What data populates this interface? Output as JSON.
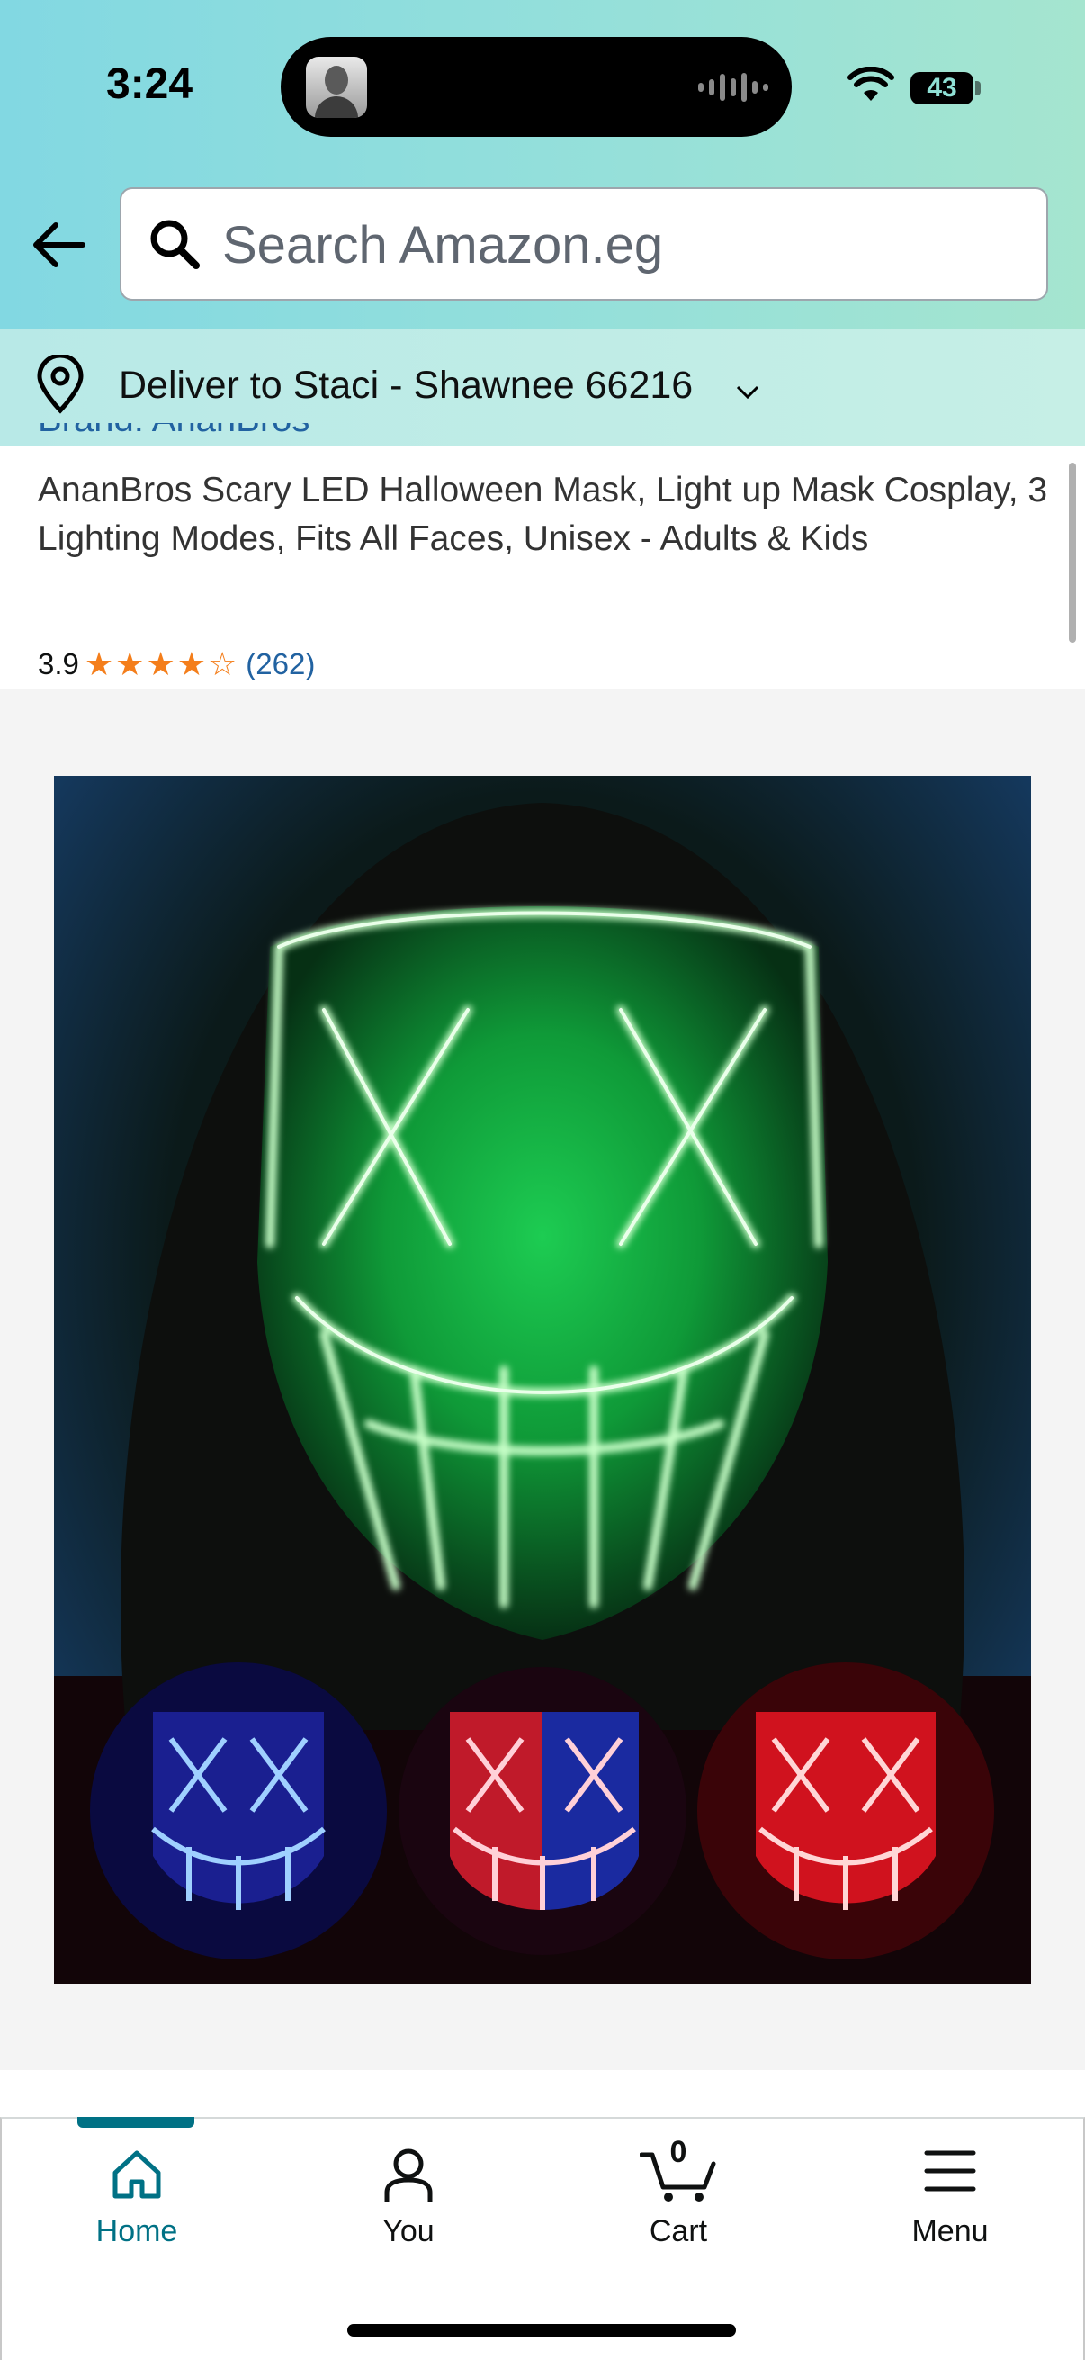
{
  "status_bar": {
    "time": "3:24",
    "battery": "43"
  },
  "header": {
    "search_placeholder": "Search Amazon.eg",
    "deliver_to": "Deliver to Staci - Shawnee 66216"
  },
  "product": {
    "brand": "Brand: AnanBros",
    "title": "AnanBros Scary LED Halloween Mask, Light up Mask Cosplay, 3 Lighting Modes, Fits All Faces, Unisex - Adults & Kids",
    "rating": "3.9",
    "rating_count": "(262)",
    "stars_filled": 3.9,
    "image": {
      "main_color": "#1ee65a",
      "thumbnail_colors": [
        "#2a5bff",
        "#ff2a40",
        "#ff3040"
      ]
    }
  },
  "tabs": [
    {
      "label": "Home",
      "icon": "home-icon",
      "active": true
    },
    {
      "label": "You",
      "icon": "person-icon",
      "active": false
    },
    {
      "label": "Cart",
      "icon": "cart-icon",
      "active": false,
      "count": "0"
    },
    {
      "label": "Menu",
      "icon": "menu-icon",
      "active": false
    }
  ],
  "colors": {
    "accent": "#007185",
    "link": "#2162a1",
    "star": "#f47e1b"
  }
}
